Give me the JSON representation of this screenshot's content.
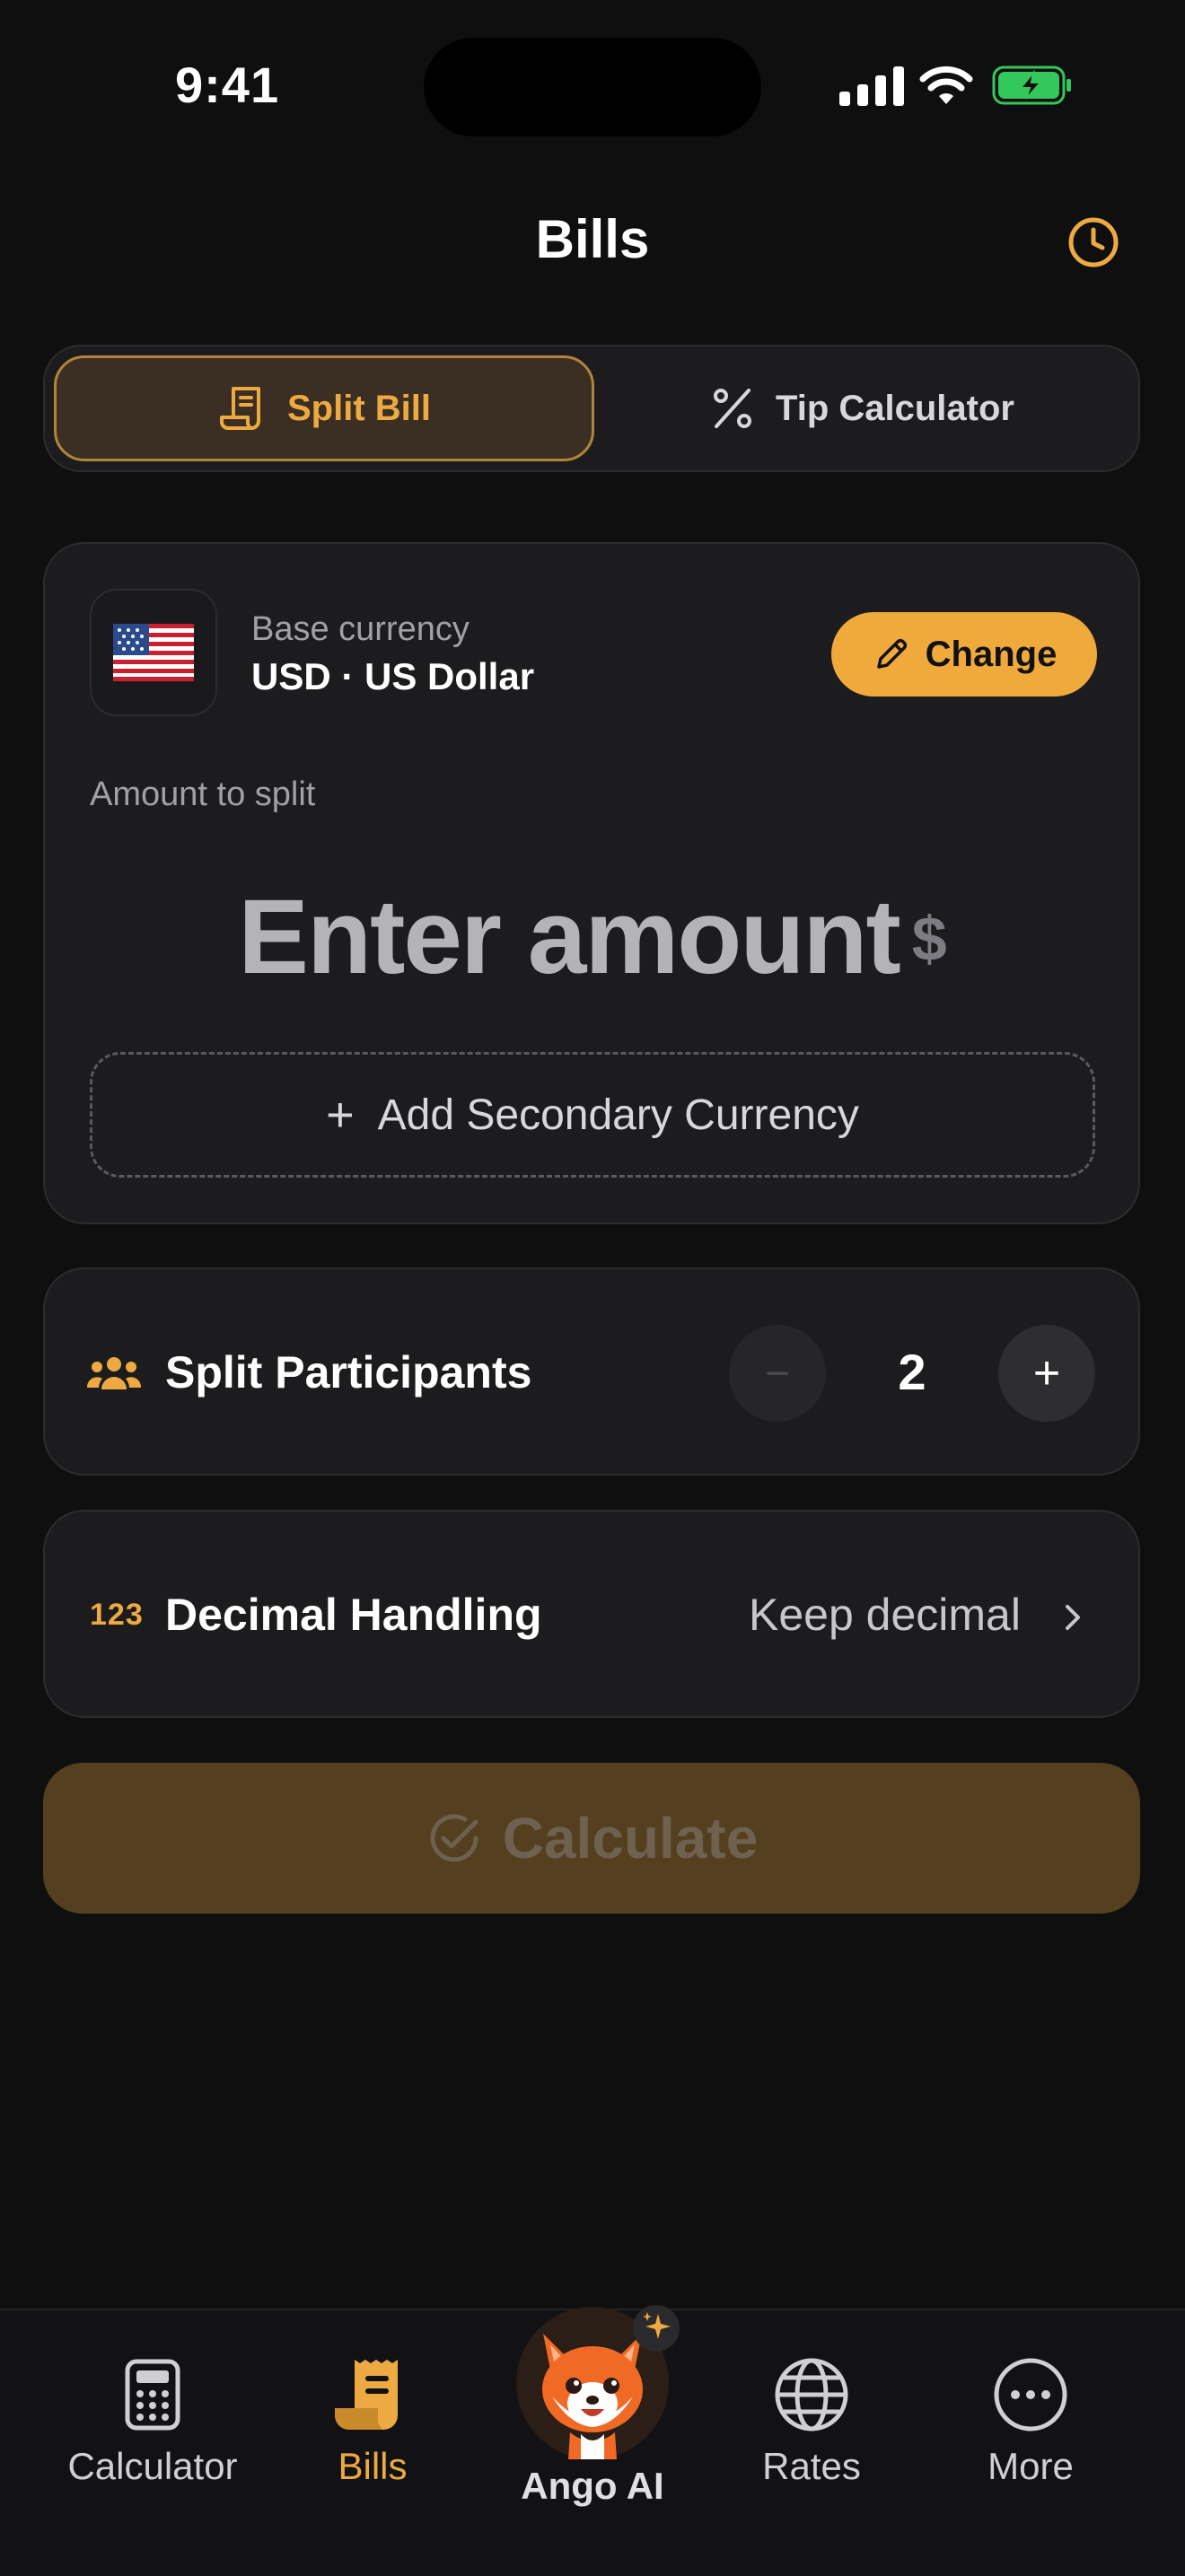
{
  "status": {
    "time": "9:41"
  },
  "header": {
    "title": "Bills"
  },
  "tabs": {
    "split_bill": "Split Bill",
    "tip_calculator": "Tip Calculator"
  },
  "currency": {
    "flag": "🇺🇸",
    "base_label": "Base currency",
    "base_value": "USD · US Dollar",
    "change_label": "Change"
  },
  "amount": {
    "label": "Amount to split",
    "placeholder": "Enter amount",
    "unit": "$"
  },
  "secondary": {
    "label": "Add Secondary Currency",
    "plus": "+"
  },
  "participants": {
    "label": "Split Participants",
    "count": "2",
    "minus": "−",
    "plus": "+"
  },
  "decimal": {
    "icon_text": "123",
    "label": "Decimal Handling",
    "value": "Keep decimal"
  },
  "calculate": {
    "label": "Calculate"
  },
  "tabbar": {
    "calculator": "Calculator",
    "bills": "Bills",
    "ai": "Ango AI",
    "rates": "Rates",
    "more": "More"
  },
  "colors": {
    "accent": "#eeaa42",
    "background": "#0f0f10",
    "card": "#1c1c1e",
    "battery": "#34c759"
  }
}
